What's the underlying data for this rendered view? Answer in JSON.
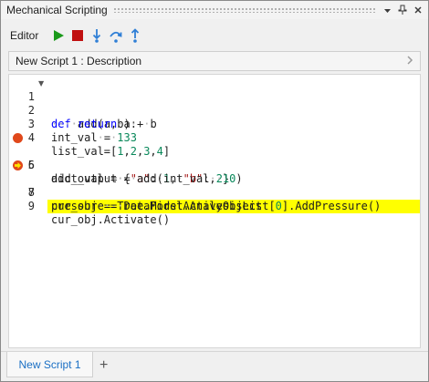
{
  "window": {
    "title": "Mechanical Scripting",
    "title_icons": [
      "chevron-down-icon",
      "pin-icon",
      "close-icon"
    ]
  },
  "toolbar": {
    "label": "Editor",
    "buttons": [
      {
        "name": "run",
        "icon": "play-icon",
        "color": "#1a9a1a"
      },
      {
        "name": "stop",
        "icon": "stop-icon",
        "color": "#c01010"
      },
      {
        "name": "step-into",
        "icon": "step-into-icon",
        "color": "#2f7fd6"
      },
      {
        "name": "step-over",
        "icon": "step-over-icon",
        "color": "#2f7fd6"
      },
      {
        "name": "step-out",
        "icon": "step-out-icon",
        "color": "#2f7fd6"
      }
    ]
  },
  "description": {
    "text": "New Script 1  : Description",
    "arrow_icon": "chevron-right-icon"
  },
  "editor": {
    "current_line": 7,
    "breakpoints": [
      5,
      7
    ],
    "lines": [
      {
        "num": "1",
        "text": "def add(a,b):"
      },
      {
        "num": "2",
        "text": "    return a + b"
      },
      {
        "num": "3",
        "text": "int_val = 133"
      },
      {
        "num": "4",
        "text": "list_val=[1,2,3,4]"
      },
      {
        "num": "5",
        "text": "dict_val = {\"a\": 1, \"b\": 2}"
      },
      {
        "num": "6",
        "text": "add_output = add(int_val, 10)"
      },
      {
        "num": "7",
        "text": "cur_obj = Tree.FirstActiveObject"
      },
      {
        "num": "8",
        "text": "pressure = DataModel.AnalysisList[0].AddPressure()"
      },
      {
        "num": "9",
        "text": "cur_obj.Activate()"
      }
    ]
  },
  "tabs": {
    "items": [
      {
        "label": "New Script 1"
      }
    ],
    "add_label": "+"
  },
  "colors": {
    "highlight": "#ffff00",
    "breakpoint": "#e0481b",
    "keyword": "#0000ff",
    "number": "#09885a",
    "string": "#a31515",
    "tab_text": "#1a6fc4"
  }
}
